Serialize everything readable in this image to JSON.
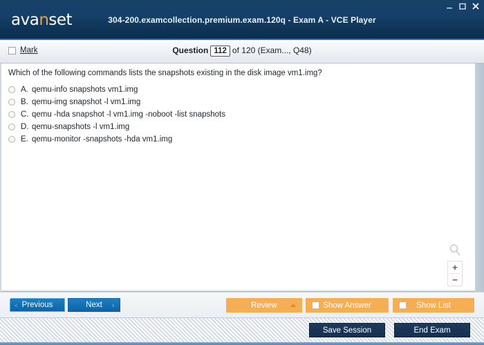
{
  "window": {
    "title": "304-200.examcollection.premium.exam.120q - Exam A - VCE Player",
    "logo_text_pre": "ava",
    "logo_text_accent": "n",
    "logo_text_post": "set",
    "controls": {
      "minimize": "minimize-icon",
      "maximize": "maximize-icon",
      "close": "close-icon"
    }
  },
  "question_bar": {
    "mark_label": "Mark",
    "mark_checked": false,
    "question_word": "Question",
    "current_number": "112",
    "rest": "of 120 (Exam..., Q48)"
  },
  "question": {
    "text": "Which of the following commands lists the snapshots existing in the disk image vm1.img?",
    "options": [
      {
        "letter": "A.",
        "text": "qemu-info snapshots vm1.img",
        "selected": false
      },
      {
        "letter": "B.",
        "text": "qemu-img snapshot -l vm1.img",
        "selected": false
      },
      {
        "letter": "C.",
        "text": "qemu -hda snapshot -l vm1.img -noboot -list snapshots",
        "selected": false
      },
      {
        "letter": "D.",
        "text": "qemu-snapshots -l vm1.img",
        "selected": false
      },
      {
        "letter": "E.",
        "text": "qemu-monitor -snapshots -hda vm1.img",
        "selected": false
      }
    ]
  },
  "zoom_widget": {
    "magnifier_icon": "magnifier-icon",
    "zoom_in_label": "+",
    "zoom_out_label": "−"
  },
  "action_bar": {
    "previous_label": "Previous",
    "previous_chevron": "‹",
    "next_label": "Next",
    "next_chevron": "›",
    "review_label": "Review",
    "show_answer_label": "Show Answer",
    "show_list_label": "Show List"
  },
  "bottom_bar": {
    "save_session_label": "Save Session",
    "end_exam_label": "End Exam"
  },
  "colors": {
    "title_blue": "#15406a",
    "accent_orange": "#f0a03c",
    "button_blue": "#1470b4",
    "button_orange": "#f5ae54",
    "button_dark": "#1d3a5c"
  }
}
